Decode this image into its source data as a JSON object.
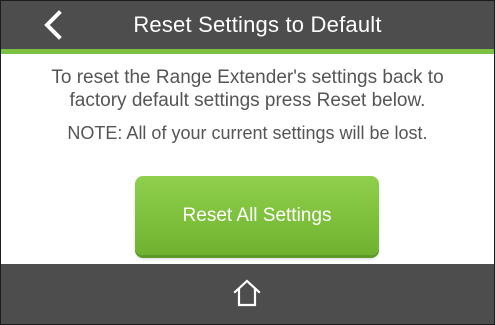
{
  "header": {
    "title": "Reset Settings to Default",
    "back_icon": "chevron-left-icon"
  },
  "content": {
    "description": "To reset the Range Extender's settings back to factory default settings press Reset below.",
    "note": "NOTE: All of your current settings will be lost."
  },
  "reset_button": {
    "label": "Reset All Settings"
  },
  "footer": {
    "home_icon": "home-icon"
  },
  "colors": {
    "header_bg": "#4d4d4d",
    "accent_green": "#7dc142",
    "button_green": "#7cbf3a",
    "text_gray": "#555555",
    "background": "#ffffff"
  }
}
